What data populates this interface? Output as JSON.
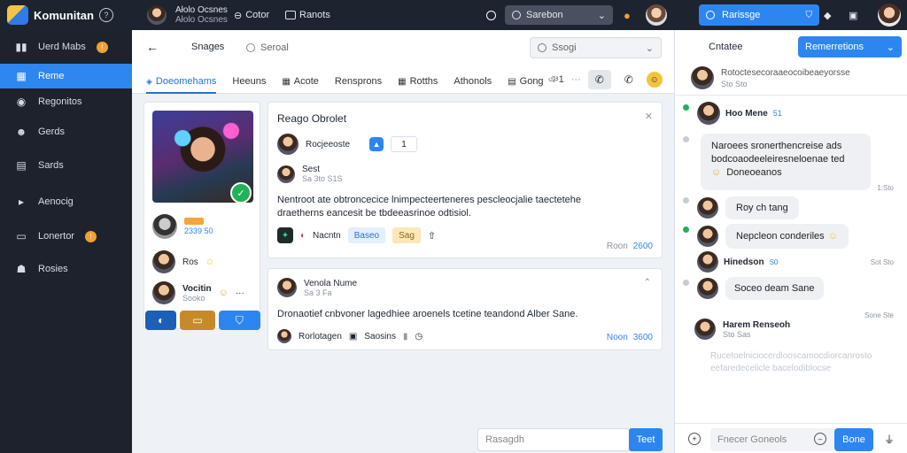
{
  "app": {
    "title": "Komunitan"
  },
  "topbar": {
    "profile_name": "Ałolo Ocsnes",
    "profile_sub": "Ałolo Ocsnes",
    "item1": "Cotor",
    "item2": "Ranots",
    "search_value": "Sarebon",
    "action_button": "Rarissge"
  },
  "sidebar": {
    "items": [
      {
        "label": "Uerd Mabs",
        "icon": "grid-icon",
        "badge": "!"
      },
      {
        "label": "Reme",
        "icon": "calendar-icon"
      },
      {
        "label": "Regonitos",
        "icon": "target-icon"
      },
      {
        "label": "Gerds",
        "icon": "people-icon"
      },
      {
        "label": "Sards",
        "icon": "doc-icon"
      },
      {
        "label": "Aenocig",
        "icon": "play-icon"
      },
      {
        "label": "Lonertor",
        "icon": "calendar-icon",
        "badge": "!"
      },
      {
        "label": "Rosies",
        "icon": "group-icon"
      }
    ]
  },
  "main": {
    "back_label": "Snages",
    "search_placeholder": "Seroal",
    "filter_value": "Ssogi",
    "tabs": [
      "Doeomehams",
      "Heeuns",
      "Acote",
      "Rensprons",
      "Rotths",
      "Athonols",
      "Gong"
    ],
    "tab_count": "ঞ1",
    "profile_cards": [
      {
        "name": "",
        "meta": "2339 50"
      },
      {
        "name": "Ros",
        "meta": ""
      },
      {
        "name": "Vocitin",
        "meta": "Sooko"
      }
    ],
    "post1": {
      "title": "Reago Obrolet",
      "sub": "Rocjeeoste",
      "rating": "1",
      "author": "Sest",
      "author_meta": "Sa 3to  S1S",
      "body": "Nentroot ate obtroncecice lnimpecteerteneres pescleocjalie taectetehe draetherns eancesit be tbdeeasrinoe odtisiol.",
      "tag_plain": "Nacntn",
      "tag_blue": "Baseo",
      "tag_yellow": "Sag",
      "footer": "Roon",
      "footer_blue": "2600"
    },
    "post2": {
      "title": "Venola Nume",
      "meta": "Sa  3  Fa",
      "body": "Dronaotief cnbvoner lagedhiee aroenels tcetine teandond Alber Sane.",
      "author": "Rorlotagen",
      "author2": "Saosins",
      "footer": "Noon",
      "footer_blue": "3600"
    }
  },
  "chat": {
    "title": "Cntatee",
    "dropdown": "Remerretions",
    "summary_line": "Rotoctesecoraaeocoibeaeyorsse",
    "summary_meta": "Sto Sto",
    "messages": [
      {
        "name": "Hoo Mene",
        "time": "51"
      },
      {
        "text1": "Naroees sronerthencreise ads",
        "text2": "bodcoaodeeleiresneloenae ted",
        "text3": "Doneoeanos",
        "time": "1:Sto"
      },
      {
        "text": "Roy ch tang"
      },
      {
        "text": "Nepcleon conderiles"
      },
      {
        "name": "Hinedson",
        "time": "S0",
        "right": "Sot Sto"
      },
      {
        "text": "Soceo deam Sane"
      },
      {
        "name": "Harem Renseoh",
        "meta": "Sto  Sas",
        "right": "Sone  Ste"
      }
    ],
    "faded_text": "Rucetoelniciocerdlooscamocdiorcanrosto eefaredecelicle bacelodiblocse",
    "input_placeholder": "Fnecer Goneols",
    "send": "Bone"
  },
  "composer": {
    "placeholder": "Rasagdh",
    "send": "Teet"
  }
}
